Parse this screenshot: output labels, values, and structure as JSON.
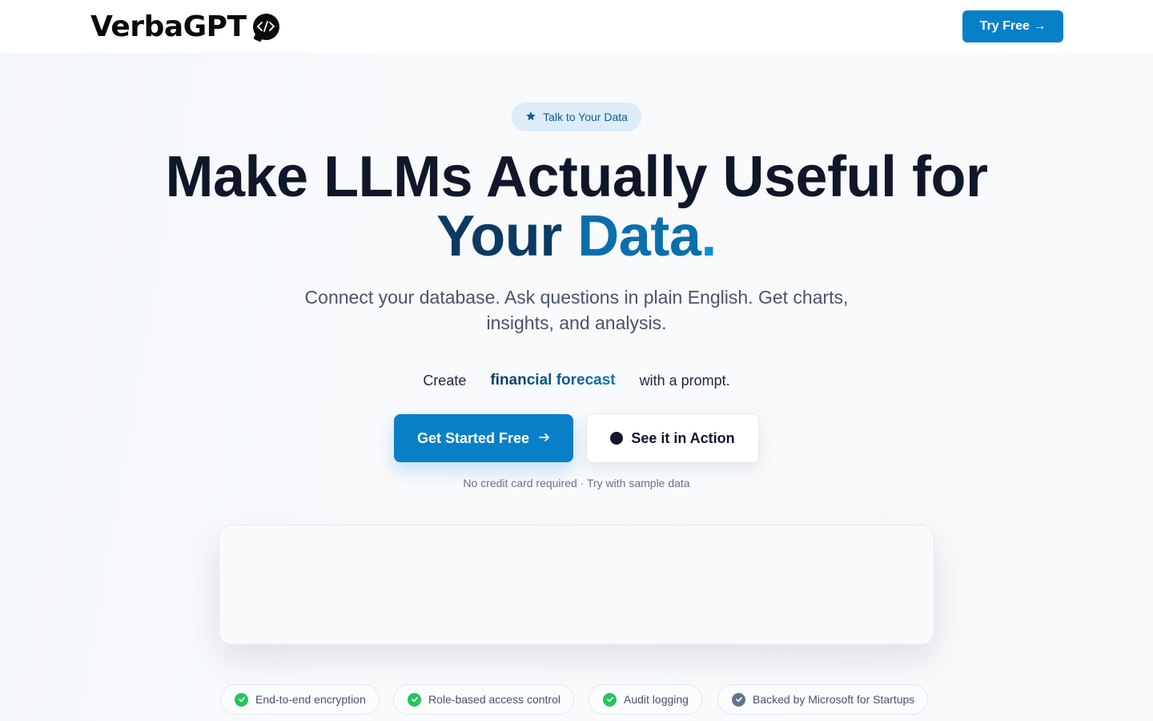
{
  "header": {
    "logo_text": "VerbaGPT",
    "logo_icon": "code-bubble-icon",
    "try_button": "Try Free →"
  },
  "hero": {
    "pill_label": "Talk to Your Data",
    "pill_icon": "star-icon",
    "headline_line1": "Make LLMs Actually Useful for",
    "headline_your": "Your",
    "headline_data": "Data",
    "headline_period": ".",
    "subtitle": "Connect your database. Ask questions in plain English. Get charts, insights, and analysis.",
    "prompt_prefix": "Create",
    "prompt_rotating": "financial forecast",
    "prompt_suffix": "with a prompt.",
    "cta_primary": "Get Started Free",
    "cta_primary_icon": "arrow-right-icon",
    "cta_secondary": "See it in Action",
    "cta_secondary_icon": "record-dot-icon",
    "note": "No credit card required · Try with sample data"
  },
  "badges": [
    {
      "label": "End-to-end encryption",
      "icon": "check-circle-icon"
    },
    {
      "label": "Role-based access control",
      "icon": "check-circle-icon"
    },
    {
      "label": "Audit logging",
      "icon": "check-circle-icon"
    },
    {
      "label": "Backed by Microsoft for Startups",
      "icon": "check-circle-icon"
    }
  ],
  "colors": {
    "brand": "#0880c8",
    "headline": "#0f172a",
    "accent_dark": "#0c3a63",
    "accent": "#0a6fab",
    "check_green": "#22c55e",
    "check_gray": "#64748b"
  }
}
